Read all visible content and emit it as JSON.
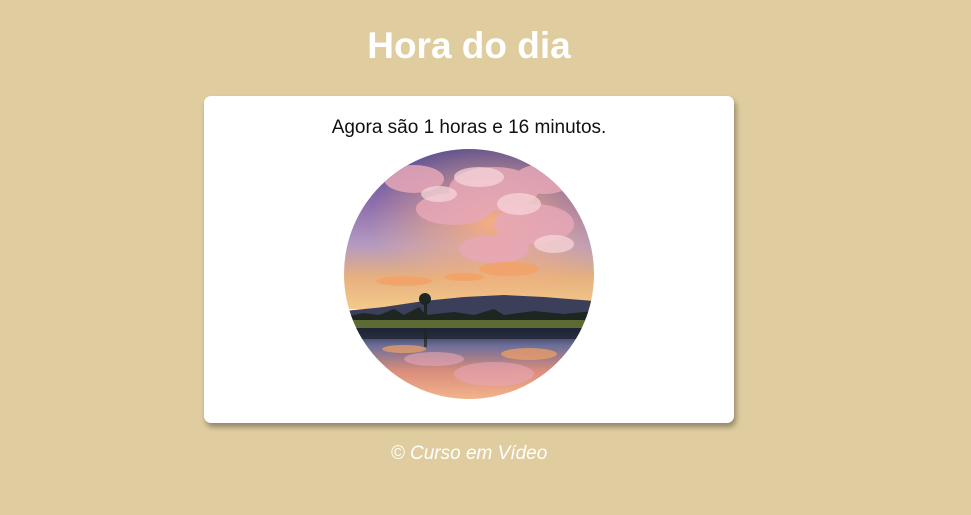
{
  "page": {
    "title": "Hora do dia",
    "background_color": "#e0cd9f"
  },
  "card": {
    "message": "Agora são 1 horas e 16 minutos.",
    "image": {
      "kind": "circular photo",
      "scene": "sunset-sky-lake-reflection"
    }
  },
  "footer": {
    "text": "© Curso em Vídeo"
  }
}
